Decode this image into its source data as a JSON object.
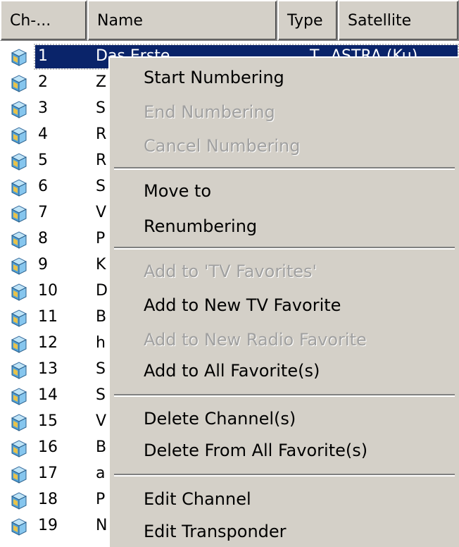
{
  "columns": {
    "channel": "Ch-...",
    "name": "Name",
    "type": "Type",
    "satellite": "Satellite"
  },
  "rows": [
    {
      "num": "1",
      "name": "Das Erste",
      "type": "T",
      "sat": "ASTRA (Ku)",
      "selected": true
    },
    {
      "num": "2",
      "name": "Z"
    },
    {
      "num": "3",
      "name": "S"
    },
    {
      "num": "4",
      "name": "R"
    },
    {
      "num": "5",
      "name": "R"
    },
    {
      "num": "6",
      "name": "S"
    },
    {
      "num": "7",
      "name": "V"
    },
    {
      "num": "8",
      "name": "P"
    },
    {
      "num": "9",
      "name": "K"
    },
    {
      "num": "10",
      "name": "D"
    },
    {
      "num": "11",
      "name": "B"
    },
    {
      "num": "12",
      "name": "h"
    },
    {
      "num": "13",
      "name": "S"
    },
    {
      "num": "14",
      "name": "S"
    },
    {
      "num": "15",
      "name": "V"
    },
    {
      "num": "16",
      "name": "B"
    },
    {
      "num": "17",
      "name": "a"
    },
    {
      "num": "18",
      "name": "P"
    },
    {
      "num": "19",
      "name": "N"
    }
  ],
  "menu": {
    "start_numbering": "Start Numbering",
    "end_numbering": "End Numbering",
    "cancel_numbering": "Cancel Numbering",
    "move_to": "Move to",
    "renumbering": "Renumbering",
    "add_tv_favorites": "Add to 'TV Favorites'",
    "add_new_tv_favorite": "Add to New TV Favorite",
    "add_new_radio_favorite": "Add to New Radio Favorite",
    "add_all_favorites": "Add to All Favorite(s)",
    "delete_channels": "Delete Channel(s)",
    "delete_from_all_favorites": "Delete From All Favorite(s)",
    "edit_channel": "Edit Channel",
    "edit_transponder": "Edit Transponder"
  },
  "icon": "tv-channel-icon",
  "colors": {
    "selection": "#0a246a",
    "menu_bg": "#d4d0c8",
    "disabled_text": "#a0a0a0"
  }
}
